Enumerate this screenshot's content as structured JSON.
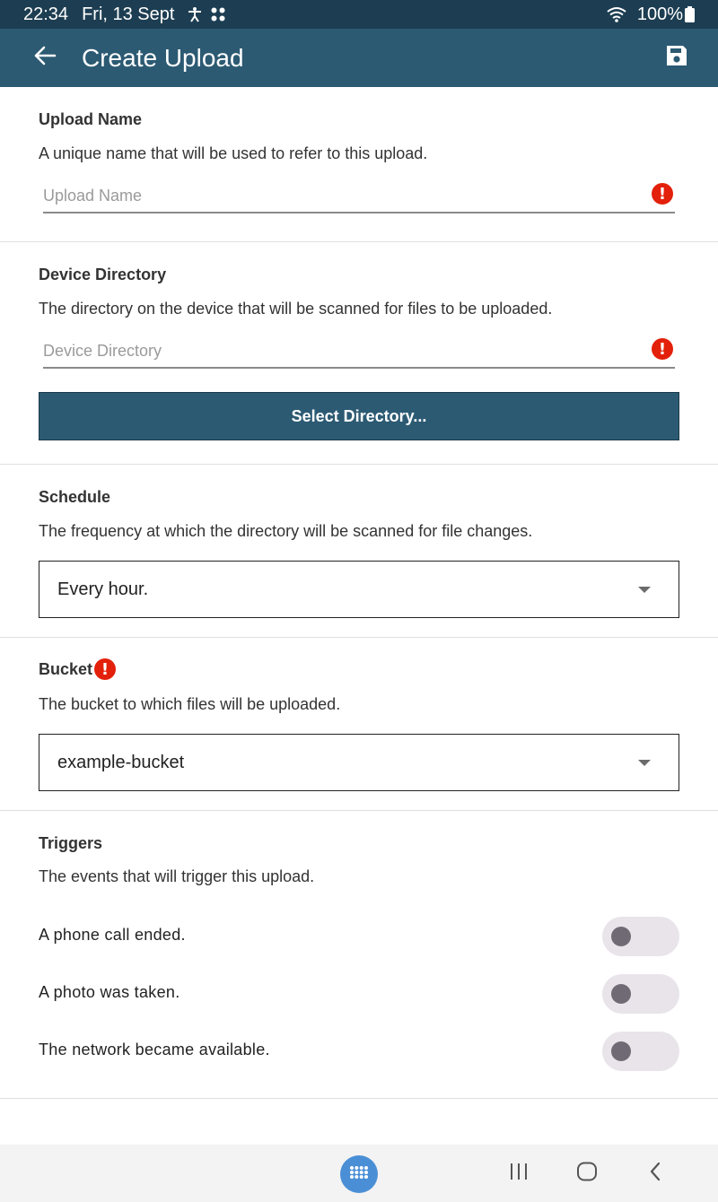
{
  "status_bar": {
    "time": "22:34",
    "date": "Fri, 13 Sept",
    "battery": "100%",
    "icons": [
      "accessibility-icon",
      "dots-icon",
      "wifi-icon",
      "battery-icon"
    ]
  },
  "app_bar": {
    "title": "Create Upload",
    "back_icon": "arrow-left-icon",
    "save_icon": "save-icon"
  },
  "upload_name": {
    "title": "Upload Name",
    "description": "A unique name that will be used to refer to this upload.",
    "placeholder": "Upload Name",
    "value": ""
  },
  "device_directory": {
    "title": "Device Directory",
    "description": "The directory on the device that will be scanned for files to be uploaded.",
    "placeholder": "Device Directory",
    "value": "",
    "button_label": "Select Directory..."
  },
  "schedule": {
    "title": "Schedule",
    "description": "The frequency at which the directory will be scanned for file changes.",
    "selected": "Every hour."
  },
  "bucket": {
    "title": "Bucket",
    "description": "The bucket to which files will be uploaded.",
    "selected": "example-bucket"
  },
  "triggers": {
    "title": "Triggers",
    "description": "The events that will trigger this upload.",
    "items": [
      {
        "label": "A phone call ended.",
        "enabled": false
      },
      {
        "label": "A photo was taken.",
        "enabled": false
      },
      {
        "label": "The network became available.",
        "enabled": false
      }
    ]
  },
  "colors": {
    "status_bar": "#1d3e52",
    "app_bar": "#2c5a73",
    "error": "#e3200a",
    "toggle_track": "#e8e4ea",
    "toggle_knob": "#6f6a73",
    "apps_button": "#4a8fd6"
  }
}
